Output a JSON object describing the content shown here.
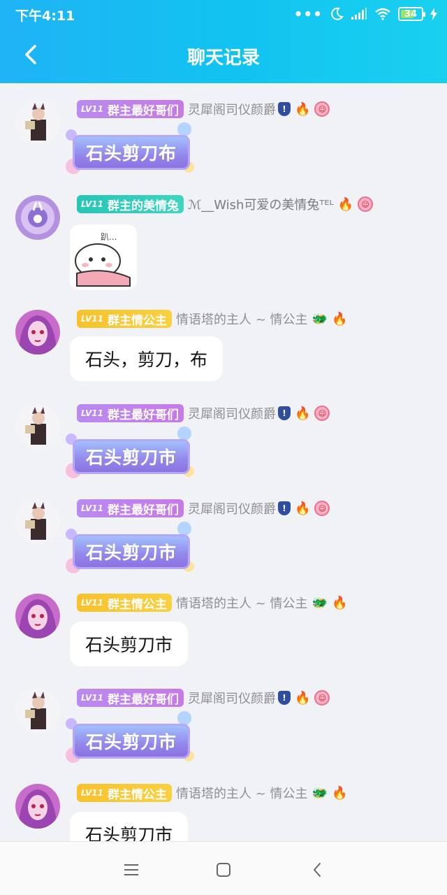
{
  "status_bar": {
    "time": "下午4:11",
    "dots": "•••",
    "battery_level": "34",
    "battery_color": "#9be46b"
  },
  "header": {
    "title": "聊天记录",
    "back_icon": "chevron-left-icon",
    "gradient_start": "#1fb3f5",
    "gradient_end": "#1ad0ef"
  },
  "messages": [
    {
      "badge_level": "LV11",
      "badge_title": "群主最好哥们",
      "badge_color": "purple",
      "nickname": "灵犀阁司仪颜爵",
      "icons": [
        "shield-icon",
        "fire-icon",
        "flower-icon"
      ],
      "type": "fancy",
      "text": "石头剪刀布"
    },
    {
      "badge_level": "LV11",
      "badge_title": "群主的美情兔",
      "badge_color": "cyan",
      "nickname": "ℳ__Wish可爱の美情兔ᵀᴱᴸ",
      "icons": [
        "fire-icon",
        "flower-icon"
      ],
      "type": "sticker",
      "text": "",
      "sticker_label": "趴..."
    },
    {
      "badge_level": "LV11",
      "badge_title": "群主情公主",
      "badge_color": "gold",
      "nickname": "情语塔的主人 ~ 情公主",
      "icons": [
        "dragon-icon",
        "fire-icon"
      ],
      "type": "plain",
      "text": "石头，剪刀，布"
    },
    {
      "badge_level": "LV11",
      "badge_title": "群主最好哥们",
      "badge_color": "purple",
      "nickname": "灵犀阁司仪颜爵",
      "icons": [
        "shield-icon",
        "fire-icon",
        "flower-icon"
      ],
      "type": "fancy",
      "text": "石头剪刀市"
    },
    {
      "badge_level": "LV11",
      "badge_title": "群主最好哥们",
      "badge_color": "purple",
      "nickname": "灵犀阁司仪颜爵",
      "icons": [
        "shield-icon",
        "fire-icon",
        "flower-icon"
      ],
      "type": "fancy",
      "text": "石头剪刀市"
    },
    {
      "badge_level": "LV11",
      "badge_title": "群主情公主",
      "badge_color": "gold",
      "nickname": "情语塔的主人 ~ 情公主",
      "icons": [
        "dragon-icon",
        "fire-icon"
      ],
      "type": "plain",
      "text": "石头剪刀市"
    },
    {
      "badge_level": "LV11",
      "badge_title": "群主最好哥们",
      "badge_color": "purple",
      "nickname": "灵犀阁司仪颜爵",
      "icons": [
        "shield-icon",
        "fire-icon",
        "flower-icon"
      ],
      "type": "fancy",
      "text": "石头剪刀市"
    },
    {
      "badge_level": "LV11",
      "badge_title": "群主情公主",
      "badge_color": "gold",
      "nickname": "情语塔的主人 ~ 情公主",
      "icons": [
        "dragon-icon",
        "fire-icon"
      ],
      "type": "plain",
      "text": "石头剪刀市"
    }
  ],
  "nav": {
    "menu_icon": "menu-icon",
    "home_icon": "home-square-icon",
    "back_icon": "back-triangle-icon"
  }
}
